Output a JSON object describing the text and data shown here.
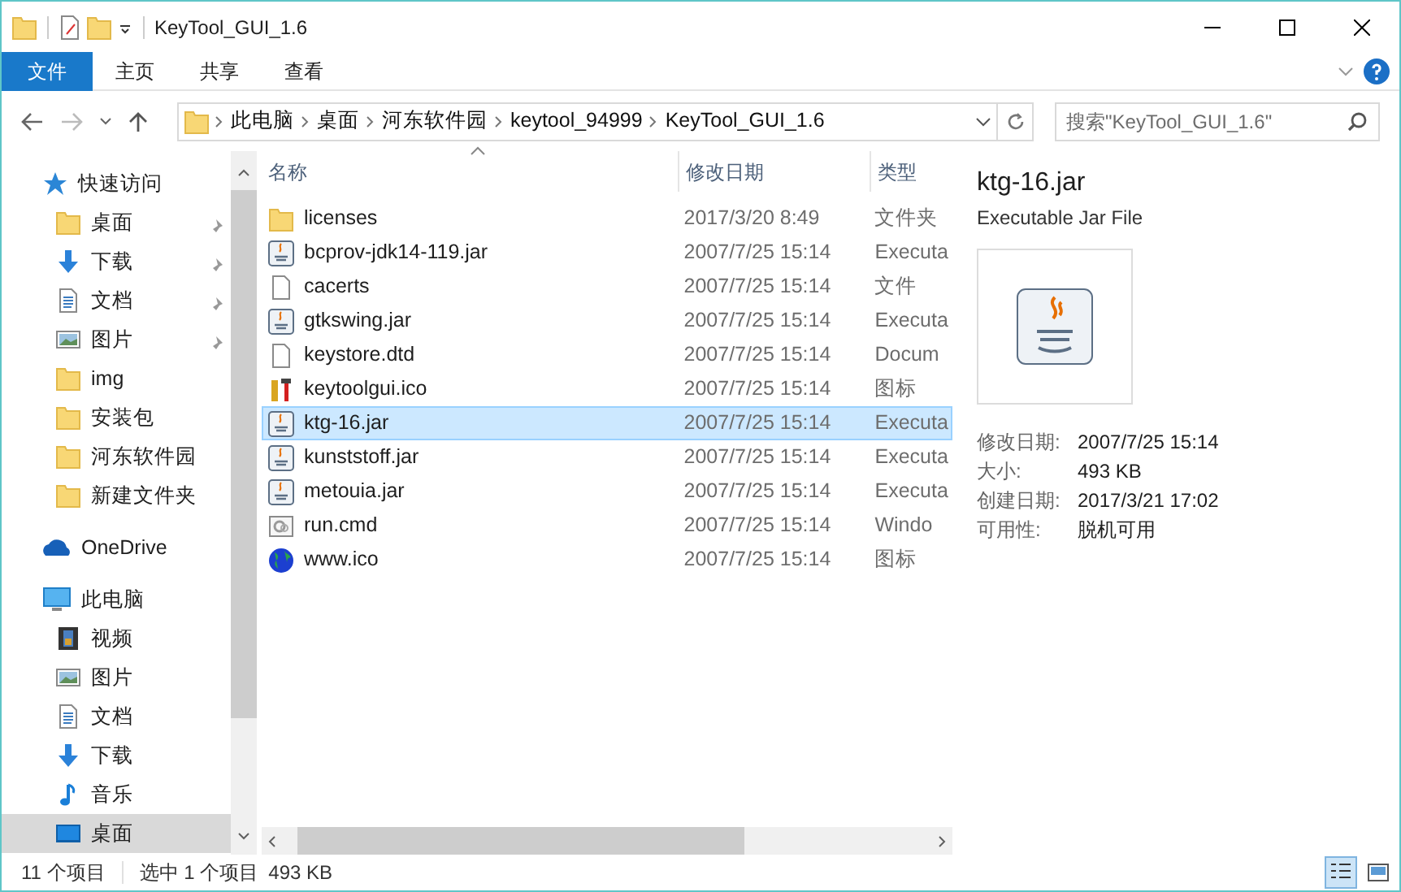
{
  "window": {
    "title": "KeyTool_GUI_1.6"
  },
  "ribbon_tabs": [
    {
      "label": "文件",
      "kind": "file"
    },
    {
      "label": "主页",
      "kind": "tab"
    },
    {
      "label": "共享",
      "kind": "tab"
    },
    {
      "label": "查看",
      "kind": "tab"
    }
  ],
  "address": {
    "crumbs": [
      "此电脑",
      "桌面",
      "河东软件园",
      "keytool_94999",
      "KeyTool_GUI_1.6"
    ]
  },
  "search": {
    "placeholder": "搜索\"KeyTool_GUI_1.6\""
  },
  "nav": [
    {
      "label": "快速访问",
      "kind": "star",
      "selected": false,
      "children": [
        {
          "label": "桌面",
          "kind": "folder",
          "pinned": true,
          "selected": false
        },
        {
          "label": "下载",
          "kind": "download",
          "pinned": true,
          "selected": false
        },
        {
          "label": "文档",
          "kind": "doc",
          "pinned": true,
          "selected": false
        },
        {
          "label": "图片",
          "kind": "pictures",
          "pinned": true,
          "selected": false
        },
        {
          "label": "img",
          "kind": "folder",
          "pinned": false,
          "selected": false
        },
        {
          "label": "安装包",
          "kind": "folder",
          "pinned": false,
          "selected": false
        },
        {
          "label": "河东软件园",
          "kind": "folder",
          "pinned": false,
          "selected": false
        },
        {
          "label": "新建文件夹",
          "kind": "folder",
          "pinned": false,
          "selected": false
        }
      ]
    },
    {
      "label": "OneDrive",
      "kind": "cloud",
      "selected": false
    },
    {
      "label": "此电脑",
      "kind": "pc",
      "selected": false,
      "children": [
        {
          "label": "视频",
          "kind": "video",
          "selected": false
        },
        {
          "label": "图片",
          "kind": "pictures",
          "selected": false
        },
        {
          "label": "文档",
          "kind": "doc",
          "selected": false
        },
        {
          "label": "下载",
          "kind": "download",
          "selected": false
        },
        {
          "label": "音乐",
          "kind": "music",
          "selected": false
        },
        {
          "label": "桌面",
          "kind": "desktop",
          "selected": true
        }
      ]
    }
  ],
  "columns": [
    {
      "label": "名称",
      "sorted": true
    },
    {
      "label": "修改日期",
      "sorted": false
    },
    {
      "label": "类型",
      "sorted": false
    }
  ],
  "files": [
    {
      "name": "licenses",
      "date": "2017/3/20 8:49",
      "type": "文件夹",
      "kind": "folder",
      "selected": false
    },
    {
      "name": "bcprov-jdk14-119.jar",
      "date": "2007/7/25 15:14",
      "type": "Executa",
      "kind": "jar",
      "selected": false
    },
    {
      "name": "cacerts",
      "date": "2007/7/25 15:14",
      "type": "文件",
      "kind": "file",
      "selected": false
    },
    {
      "name": "gtkswing.jar",
      "date": "2007/7/25 15:14",
      "type": "Executa",
      "kind": "jar",
      "selected": false
    },
    {
      "name": "keystore.dtd",
      "date": "2007/7/25 15:14",
      "type": "Docum",
      "kind": "file",
      "selected": false
    },
    {
      "name": "keytoolgui.ico",
      "date": "2007/7/25 15:14",
      "type": "图标",
      "kind": "tools",
      "selected": false
    },
    {
      "name": "ktg-16.jar",
      "date": "2007/7/25 15:14",
      "type": "Executa",
      "kind": "jar",
      "selected": true
    },
    {
      "name": "kunststoff.jar",
      "date": "2007/7/25 15:14",
      "type": "Executa",
      "kind": "jar",
      "selected": false
    },
    {
      "name": "metouia.jar",
      "date": "2007/7/25 15:14",
      "type": "Executa",
      "kind": "jar",
      "selected": false
    },
    {
      "name": "run.cmd",
      "date": "2007/7/25 15:14",
      "type": "Windo",
      "kind": "cmd",
      "selected": false
    },
    {
      "name": "www.ico",
      "date": "2007/7/25 15:14",
      "type": "图标",
      "kind": "globe",
      "selected": false
    }
  ],
  "preview": {
    "name": "ktg-16.jar",
    "type": "Executable Jar File",
    "properties": [
      {
        "label": "修改日期:",
        "value": "2007/7/25 15:14"
      },
      {
        "label": "大小:",
        "value": "493 KB"
      },
      {
        "label": "创建日期:",
        "value": "2017/3/21 17:02"
      },
      {
        "label": "可用性:",
        "value": "脱机可用"
      }
    ]
  },
  "status_bar": {
    "count": "11 个项目",
    "selection": "选中 1 个项目",
    "size": "493 KB"
  },
  "view_buttons": [
    {
      "kind": "details",
      "selected": true
    },
    {
      "kind": "thumbnails",
      "selected": false
    }
  ]
}
